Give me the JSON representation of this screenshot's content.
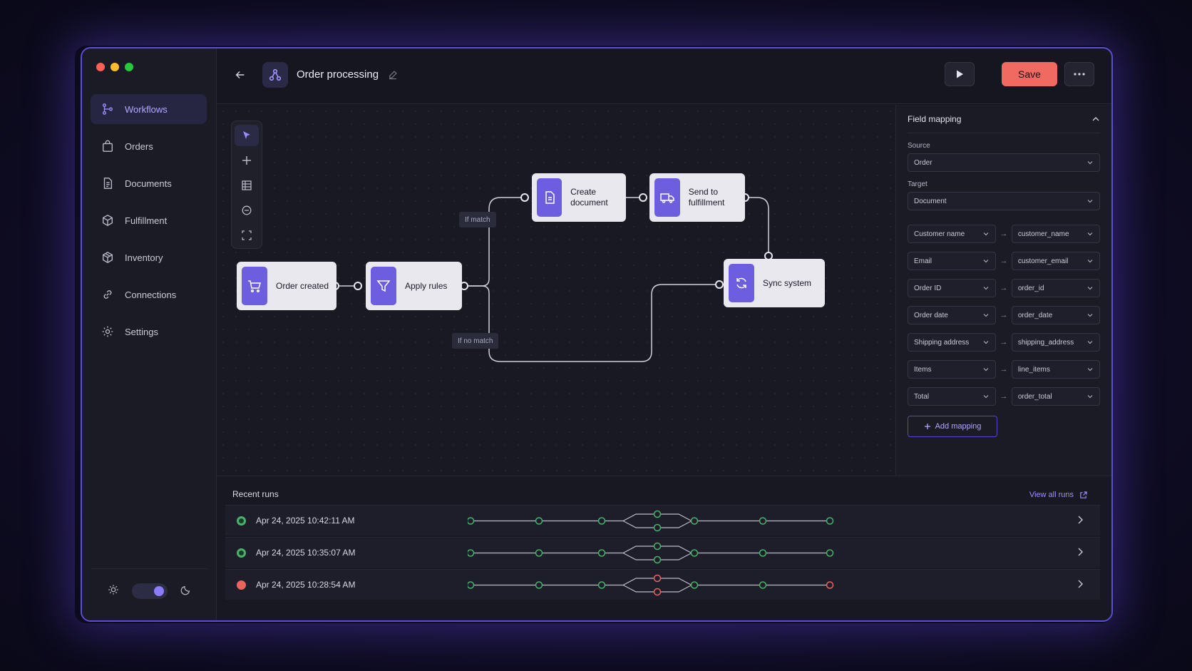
{
  "sidebar": {
    "items": [
      {
        "label": "Workflows",
        "icon": "workflow-icon",
        "active": true
      },
      {
        "label": "Orders",
        "icon": "bag-icon"
      },
      {
        "label": "Documents",
        "icon": "document-icon"
      },
      {
        "label": "Fulfillment",
        "icon": "box-icon"
      },
      {
        "label": "Inventory",
        "icon": "cube-icon"
      },
      {
        "label": "Connections",
        "icon": "link-icon"
      },
      {
        "label": "Settings",
        "icon": "gear-icon"
      }
    ]
  },
  "header": {
    "title": "Order processing",
    "save_label": "Save"
  },
  "canvas": {
    "nodes": {
      "order_created": "Order created",
      "apply_rules": "Apply rules",
      "create_document": "Create document",
      "send_to_fulfillment": "Send to fulfillment",
      "sync_system": "Sync system"
    },
    "branches": {
      "match": "If match",
      "no_match": "If no match"
    }
  },
  "field_mapping": {
    "title": "Field mapping",
    "source_label": "Source",
    "source_value": "Order",
    "target_label": "Target",
    "target_value": "Document",
    "rows": [
      {
        "source": "Customer name",
        "target": "customer_name"
      },
      {
        "source": "Email",
        "target": "customer_email"
      },
      {
        "source": "Order ID",
        "target": "order_id"
      },
      {
        "source": "Order date",
        "target": "order_date"
      },
      {
        "source": "Shipping address",
        "target": "shipping_address"
      },
      {
        "source": "Items",
        "target": "line_items"
      },
      {
        "source": "Total",
        "target": "order_total"
      }
    ],
    "add_label": "Add mapping"
  },
  "recent_runs": {
    "title": "Recent runs",
    "view_all": "View all runs",
    "runs": [
      {
        "time": "Apr 24, 2025  10:42:11 AM",
        "status": "success"
      },
      {
        "time": "Apr 24, 2025  10:35:07 AM",
        "status": "success"
      },
      {
        "time": "Apr 24, 2025  10:28:54 AM",
        "status": "error"
      }
    ]
  },
  "colors": {
    "accent": "#6d5ee0",
    "save": "#f06a62",
    "success": "#46b36a",
    "error": "#e8645d"
  }
}
